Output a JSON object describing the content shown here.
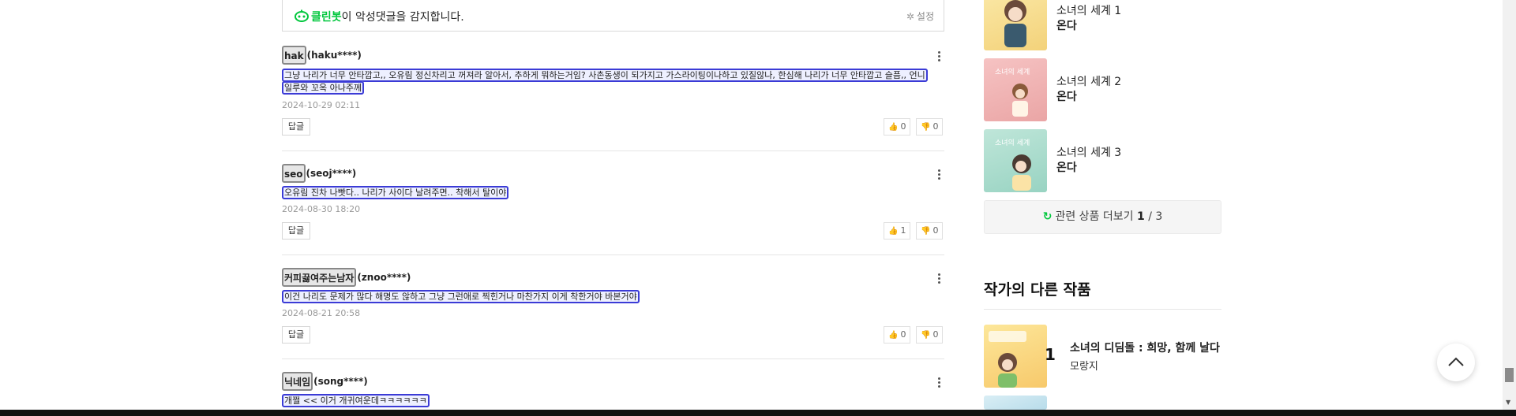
{
  "clean_bot": {
    "name": "클린봇",
    "message": "이 악성댓글을 감지합니다.",
    "settings_label": "설정"
  },
  "comments": [
    {
      "nickname": "hak",
      "user_id": "(haku****)",
      "body": "그냥 나리가 너무 안타깝고,, 오유림 정신차리고 꺼져라 알아서, 추하게 뭐하는거임? 사촌동생이 되가지고 가스라이팅이나하고 있질않나, 한심해 나리가 너무 안타깝고 슬픔,, 언니 일루와 꼬옥 아나주께",
      "date": "2024-10-29 02:11",
      "reply_label": "답글",
      "likes": "0",
      "dislikes": "0"
    },
    {
      "nickname": "seo",
      "user_id": "(seoj****)",
      "body": "오유림 진차 나빳다.. 나리가 사이다 날려주면.. 착해서 탈이야",
      "date": "2024-08-30 18:20",
      "reply_label": "답글",
      "likes": "1",
      "dislikes": "0"
    },
    {
      "nickname": "커피끓여주는남자",
      "user_id": "(znoo****)",
      "body": "이건 나리도 문제가 많다 해명도 않하고 그냥 그런애로 찍힌거나 마찬가지 이게 착한거야 바본거야",
      "date": "2024-08-21 20:58",
      "reply_label": "답글",
      "likes": "0",
      "dislikes": "0"
    },
    {
      "nickname": "닉네임",
      "user_id": "(song****)",
      "body": "개쩔 << 이거 개귀여운데ㅋㅋㅋㅋㅋㅋ"
    }
  ],
  "related_books": [
    {
      "title": "소녀의 세계 1",
      "author": "온다"
    },
    {
      "title": "소녀의 세계 2",
      "author": "온다"
    },
    {
      "title": "소녀의 세계 3",
      "author": "온다"
    }
  ],
  "more_related": {
    "label": "관련 상품 더보기",
    "current": "1",
    "total": "/ 3"
  },
  "other_works": {
    "section_title": "작가의 다른 작품",
    "items": [
      {
        "rank": "1",
        "title": "소녀의 디딤돌 : 희망, 함께 날다",
        "author": "모랑지"
      }
    ]
  },
  "icons": {
    "clean_bot": "robot-icon",
    "settings": "gear-icon",
    "more": "more-vertical-icon",
    "like": "thumbs-up-icon",
    "dislike": "thumbs-down-icon",
    "refresh": "refresh-icon",
    "top": "chevron-up-icon"
  },
  "colors": {
    "brand_green": "#00c73c",
    "highlight_border": "#3b3bd6"
  }
}
